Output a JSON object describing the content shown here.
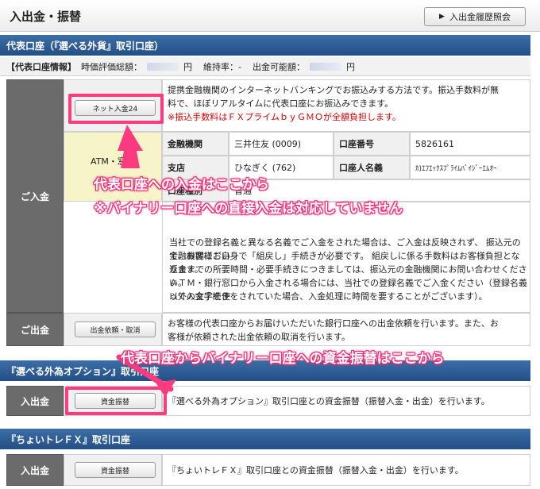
{
  "header": {
    "title": "入出金・振替",
    "history_button": "入出金履歴照会",
    "history_icon": "triangle-right-icon"
  },
  "rep_account": {
    "section_title": "代表口座（『選べる外貨』取引口座）",
    "info": {
      "label": "【代表口座情報】",
      "eval_label": "時価評価総額：",
      "eval_unit": "円",
      "margin_label": "維持率：-",
      "withdraw_label": "出金可能額：",
      "withdraw_unit": "円"
    },
    "deposit_label": "ご入金",
    "net_button": "ネット入金24",
    "net_text_1": "提携金融機関のインターネットバンキングでお振込みする方法です。振込手数料が無",
    "net_text_2": "料で、ほぼリアルタイムに代表口座にお振込みできます。",
    "net_note": "※振込手数料はＦＸプライムｂｙＧＭＯが全額負担します。",
    "atm_label": "ATM・窓口",
    "bank": {
      "bank_key": "金融機関",
      "bank_val": "三井住友 (0009)",
      "acct_no_key": "口座番号",
      "acct_no_val": "5826161",
      "branch_key": "支店",
      "branch_val": "ひなぎく (762)",
      "holder_key": "口座人名義",
      "holder_val": "ｶ)ｴﾌｴｯｸｽﾌﾟﾗｲﾑﾊﾞｲｼﾞｰｴﾑｵｰ",
      "type_key": "口座種別",
      "type_val": "普通"
    },
    "notes": [
      "当社での登録名義と異なる名義でご入金をされた場合は、ご入金は反映されず、 振込元の金融機関におい",
      "て、お客様ご自身で「組戻し」手続きが必要です。 組戻しに係る手数料はお客様負担となります。",
      "返金までの所要時間・必要手続きにつきましては、振込元の金融機関にお問い合わせください。",
      "ＡＴＭ・銀行窓口から入金される場合には、当社での登録名義でご入金ください（登録名義以外の文字を使",
      "って入金手続きをされていた場合、入金処理に時間を要することがございます）。"
    ],
    "withdraw_label": "ご出金",
    "withdraw_button": "出金依頼・取消",
    "withdraw_text_1": "お客様の代表口座からお届けいただいた銀行口座への出金依頼を行います。また、お",
    "withdraw_text_2": "客様が依頼された出金依頼の取消を行います。"
  },
  "option_account": {
    "section_title": "『選べる外為オプション』取引口座",
    "row_label": "入出金",
    "button": "資金振替",
    "text": "『選べる外為オプション』取引口座との資金振替（振替入金・出金）を行います。"
  },
  "choi_account": {
    "section_title": "『ちょいトレＦＸ』取引口座",
    "row_label": "入出金",
    "button": "資金振替",
    "text": "『ちょいトレＦＸ』取引口座との資金振替（振替入金・出金）を行います。"
  },
  "annotations": {
    "deposit_here": "代表口座への入金はここから",
    "binary_note": "※バイナリー口座への直接入金は対応していません",
    "transfer_here": "代表口座からバイナリー口座への資金振替はここから",
    "accent_color": "#ff3b7f"
  }
}
